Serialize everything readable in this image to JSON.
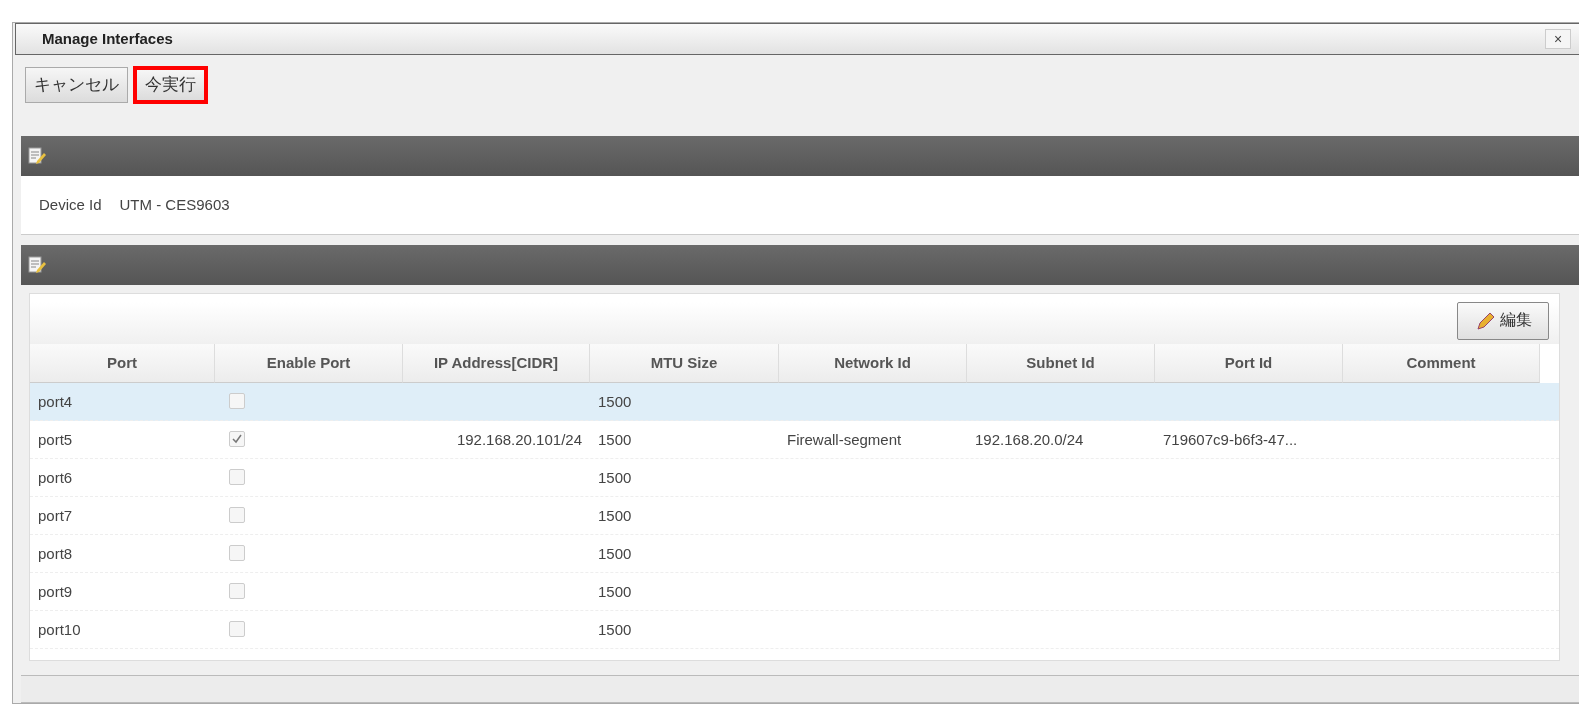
{
  "window": {
    "title": "Manage Interfaces",
    "close": "×"
  },
  "toolbar": {
    "buttons": [
      {
        "label": "キャンセル",
        "highlighted": false
      },
      {
        "label": "今実行",
        "highlighted": true
      }
    ]
  },
  "device": {
    "label": "Device Id",
    "value": "UTM - CES9603"
  },
  "grid": {
    "edit_button": "編集",
    "columns": [
      "Port",
      "Enable Port",
      "IP Address[CIDR]",
      "MTU Size",
      "Network Id",
      "Subnet Id",
      "Port Id",
      "Comment"
    ],
    "rows": [
      {
        "selected": true,
        "port": "port4",
        "enabled": false,
        "ip": "",
        "mtu": "1500",
        "network": "",
        "subnet": "",
        "port_id": ""
      },
      {
        "selected": false,
        "port": "port5",
        "enabled": true,
        "ip": "192.168.20.101/24",
        "mtu": "1500",
        "network": "Firewall-segment",
        "subnet": "192.168.20.0/24",
        "port_id": "719607c9-b6f3-47..."
      },
      {
        "selected": false,
        "port": "port6",
        "enabled": false,
        "ip": "",
        "mtu": "1500",
        "network": "",
        "subnet": "",
        "port_id": ""
      },
      {
        "selected": false,
        "port": "port7",
        "enabled": false,
        "ip": "",
        "mtu": "1500",
        "network": "",
        "subnet": "",
        "port_id": ""
      },
      {
        "selected": false,
        "port": "port8",
        "enabled": false,
        "ip": "",
        "mtu": "1500",
        "network": "",
        "subnet": "",
        "port_id": ""
      },
      {
        "selected": false,
        "port": "port9",
        "enabled": false,
        "ip": "",
        "mtu": "1500",
        "network": "",
        "subnet": "",
        "port_id": ""
      },
      {
        "selected": false,
        "port": "port10",
        "enabled": false,
        "ip": "",
        "mtu": "1500",
        "network": "",
        "subnet": "",
        "port_id": ""
      }
    ]
  }
}
